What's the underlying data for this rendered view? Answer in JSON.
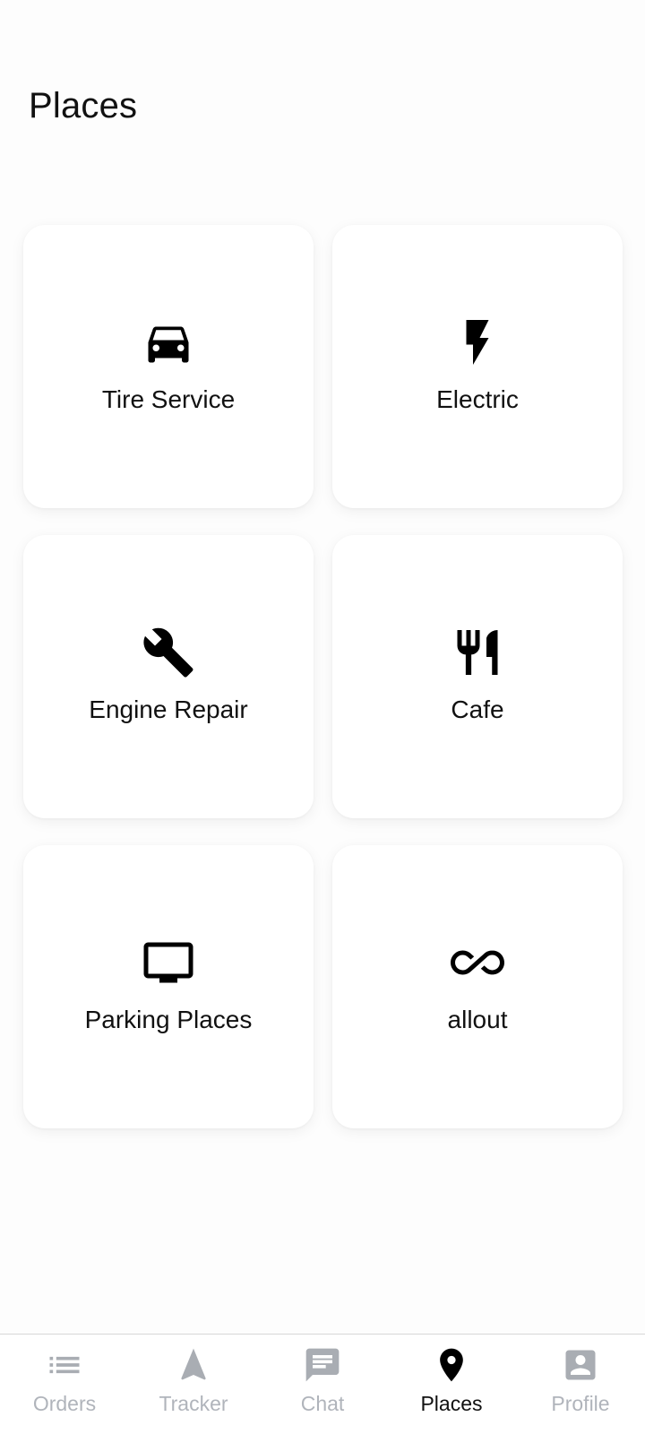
{
  "header": {
    "title": "Places"
  },
  "categories": [
    {
      "label": "Tire Service",
      "icon": "car-icon"
    },
    {
      "label": "Electric",
      "icon": "lightning-bolt-icon"
    },
    {
      "label": "Engine Repair",
      "icon": "wrench-icon"
    },
    {
      "label": "Cafe",
      "icon": "fork-knife-icon"
    },
    {
      "label": "Parking Places",
      "icon": "tv-icon"
    },
    {
      "label": "allout",
      "icon": "infinity-icon"
    }
  ],
  "bottom_nav": {
    "items": [
      {
        "label": "Orders",
        "icon": "list-icon",
        "active": false
      },
      {
        "label": "Tracker",
        "icon": "navigation-arrow-icon",
        "active": false
      },
      {
        "label": "Chat",
        "icon": "chat-bubble-icon",
        "active": false
      },
      {
        "label": "Places",
        "icon": "location-pin-icon",
        "active": true
      },
      {
        "label": "Profile",
        "icon": "profile-badge-icon",
        "active": false
      }
    ]
  },
  "colors": {
    "background": "#fdfdfd",
    "card": "#ffffff",
    "active": "#000000",
    "inactive": "#b0b4bb"
  }
}
